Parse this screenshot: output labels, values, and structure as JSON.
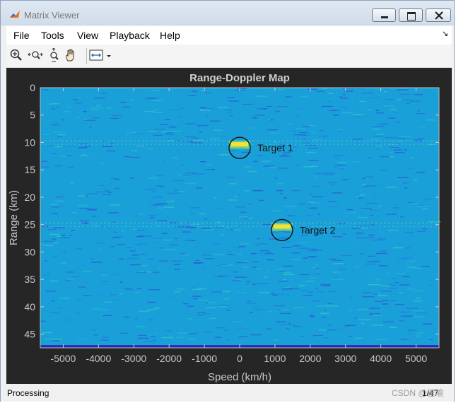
{
  "window": {
    "title": "Matrix Viewer"
  },
  "menu": {
    "items": [
      "File",
      "Tools",
      "View",
      "Playback",
      "Help"
    ]
  },
  "toolbar": {
    "tools": [
      "zoom-in-icon",
      "zoom-out-icon",
      "vertical-zoom-icon",
      "pan-icon",
      "fit-to-view-icon",
      "dropdown-arrow-icon"
    ]
  },
  "status": {
    "text": "Processing",
    "frame": "1/47"
  },
  "watermark": "CSDN @雀喻",
  "chart_data": {
    "type": "heatmap",
    "title": "Range-Doppler Map",
    "xlabel": "Speed (km/h)",
    "ylabel": "Range (km)",
    "xlim": [
      -5650,
      5650
    ],
    "ylim": [
      47.5,
      0
    ],
    "xticks": [
      -5000,
      -4000,
      -3000,
      -2000,
      -1000,
      0,
      1000,
      2000,
      3000,
      4000,
      5000
    ],
    "yticks": [
      0,
      5,
      10,
      15,
      20,
      25,
      30,
      35,
      40,
      45
    ],
    "colors": {
      "background": "#1aa0d8",
      "noise_dark": "#2b55d6",
      "noise_light": "#35c8c4",
      "hot": "#f2e23a",
      "bottom_band": "#2a2ab0"
    },
    "targets": [
      {
        "label": "Target 1",
        "speed": 0,
        "range": 11
      },
      {
        "label": "Target 2",
        "speed": 1200,
        "range": 26
      }
    ]
  }
}
